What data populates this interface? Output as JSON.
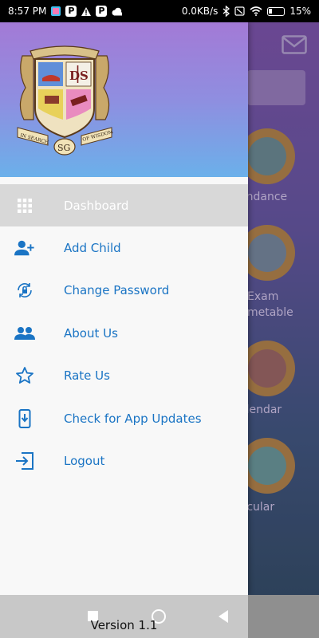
{
  "status_bar": {
    "time": "8:57 PM",
    "net_speed": "0.0KB/s",
    "battery": "15%",
    "left_icons": [
      "app-icon",
      "p-icon",
      "p-icon",
      "alert-icon",
      "p-icon",
      "cloud-icon"
    ],
    "right_icons": [
      "bluetooth-icon",
      "sim-off-icon",
      "wifi-icon",
      "battery-charging-icon"
    ]
  },
  "background": {
    "tiles": [
      {
        "label": "endance",
        "icon": "attendance-icon"
      },
      {
        "label": "Exam\nmetable",
        "icon": "exam-timetable-icon"
      },
      {
        "label": "alendar",
        "icon": "calendar-icon"
      },
      {
        "label": "ircular",
        "icon": "circular-icon"
      }
    ]
  },
  "drawer": {
    "menu": [
      {
        "label": "Dashboard",
        "icon": "grid-icon",
        "active": true
      },
      {
        "label": "Add Child",
        "icon": "add-person-icon"
      },
      {
        "label": "Change Password",
        "icon": "lock-refresh-icon"
      },
      {
        "label": "About Us",
        "icon": "people-icon"
      },
      {
        "label": "Rate Us",
        "icon": "star-icon"
      },
      {
        "label": "Check for App Updates",
        "icon": "phone-download-icon"
      },
      {
        "label": "Logout",
        "icon": "logout-icon"
      }
    ],
    "version": "Version 1.1"
  },
  "logo": {
    "banner_left": "IN SEARCH",
    "banner_right": "OF WISDOM",
    "monogram": "SG",
    "shield_text": "D|S"
  },
  "colors": {
    "menu_text": "#1a74c4",
    "active_bg": "#d8d8d8",
    "header_top": "#a37ad6",
    "header_bottom": "#6bb0ea"
  }
}
